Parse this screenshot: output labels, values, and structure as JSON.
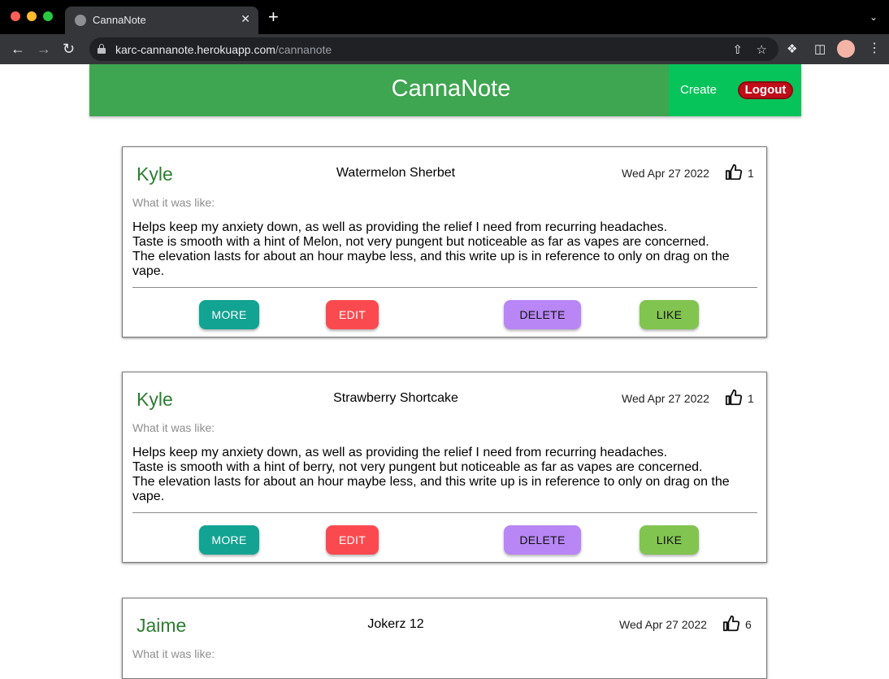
{
  "browser": {
    "tab_title": "CannaNote",
    "tab_close": "✕",
    "new_tab": "+",
    "tab_menu": "⌄",
    "url_host": "karc-cannanote.herokuapp.com",
    "url_path": "/cannanote",
    "icons": [
      "back-icon",
      "forward-icon",
      "reload-icon",
      "lock-icon",
      "share-icon",
      "star-icon",
      "extensions-icon",
      "side-panel-icon",
      "avatar",
      "menu-icon"
    ]
  },
  "header": {
    "title": "CannaNote",
    "create_label": "Create",
    "logout_label": "Logout",
    "colors": {
      "bar": "#3ea550",
      "actions": "#06c45a",
      "logout": "#c00d18"
    }
  },
  "posts": [
    {
      "author": "Kyle",
      "strain": "Watermelon Sherbet",
      "date": "Wed Apr 27 2022",
      "likes": "1",
      "label": "What it was like:",
      "body_lines": [
        "Helps keep my anxiety down, as well as providing the relief I need from recurring headaches.",
        "Taste is smooth with a hint of Melon, not very pungent but noticeable as far as vapes are concerned.",
        "The elevation lasts for about an hour maybe less, and this write up is in reference to only on drag on the",
        "vape."
      ],
      "buttons": {
        "more": "MORE",
        "edit": "EDIT",
        "delete": "DELETE",
        "like": "LIKE"
      }
    },
    {
      "author": "Kyle",
      "strain": "Strawberry Shortcake",
      "date": "Wed Apr 27 2022",
      "likes": "1",
      "label": "What it was like:",
      "body_lines": [
        "Helps keep my anxiety down, as well as providing the relief I need from recurring headaches.",
        "Taste is smooth with a hint of berry, not very pungent but noticeable as far as vapes are concerned.",
        "The elevation lasts for about an hour maybe less, and this write up is in reference to only on drag on the",
        "vape."
      ],
      "buttons": {
        "more": "MORE",
        "edit": "EDIT",
        "delete": "DELETE",
        "like": "LIKE"
      }
    },
    {
      "author": "Jaime",
      "strain": "Jokerz 12",
      "date": "Wed Apr 27 2022",
      "likes": "6",
      "label": "What it was like:"
    }
  ]
}
